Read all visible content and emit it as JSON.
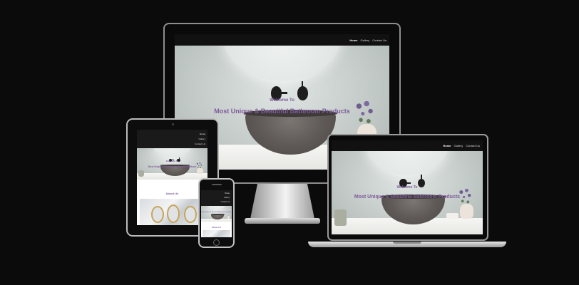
{
  "site": {
    "nav": [
      "Home",
      "Gallery",
      "Contact Us"
    ],
    "hero_welcome": "Welcome To",
    "hero_title": "Most Unique & Beautiful Bathroom Products",
    "about_title": "About Us"
  },
  "colors": {
    "background": "#0b0b0b",
    "accent": "#7e5a9b",
    "navbar": "#111111"
  }
}
